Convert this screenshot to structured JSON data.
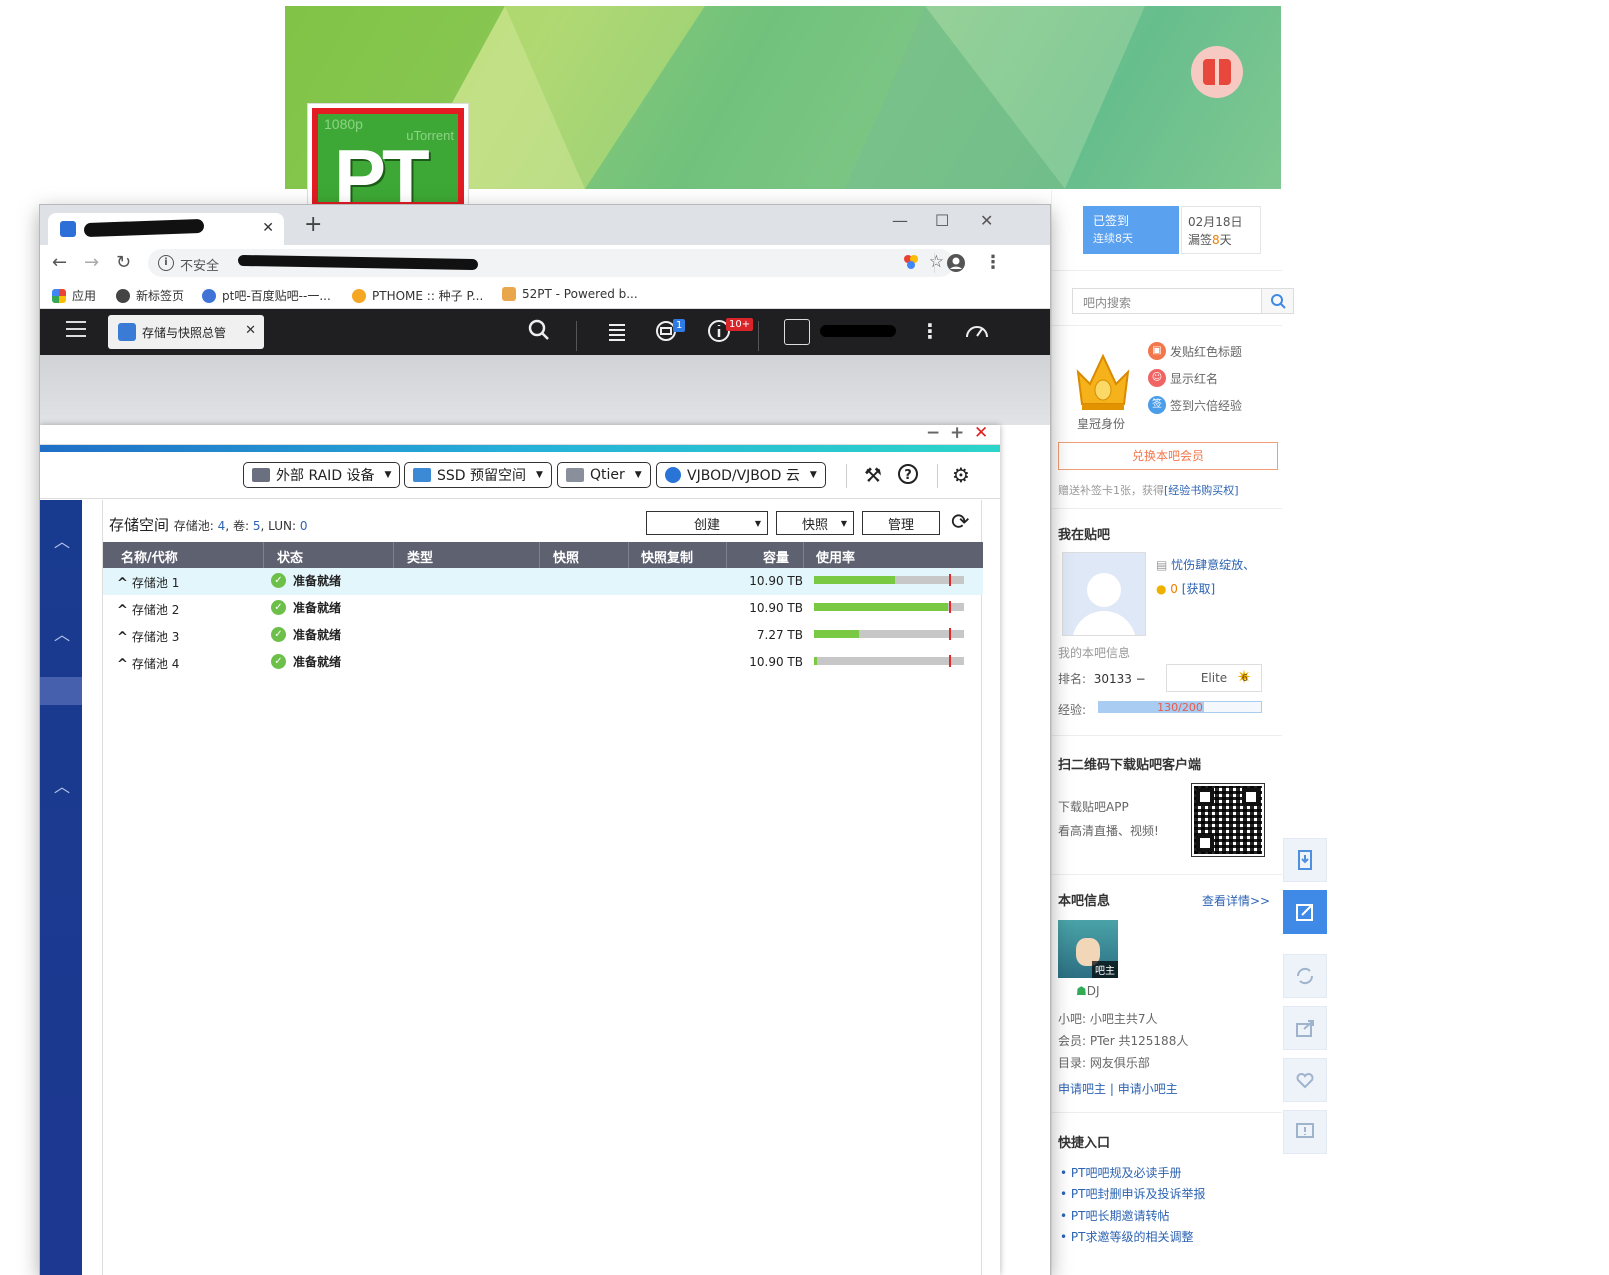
{
  "tieba": {
    "signin": {
      "status": "已签到",
      "streak": "连续8天"
    },
    "signdate": {
      "date": "02月18日",
      "missed_prefix": "漏签",
      "missed_num": "8",
      "missed_suffix": "天"
    },
    "search_placeholder": "吧内搜索",
    "crown_label": "皇冠身份",
    "perks": [
      "发贴红色标题",
      "显示红名",
      "签到六倍经验"
    ],
    "vip_button": "兑换本吧会员",
    "vip_note": "赠送补签卡1张，获得",
    "vip_note_link": "[经验书购买权]",
    "my_section_title": "我在贴吧",
    "my_name": "忧伤肆意绽放、",
    "my_coins": "0",
    "my_coins_link": "[获取]",
    "my_info_label": "我的本吧信息",
    "rank_label": "排名:",
    "rank_value": "30133 −",
    "level_name": "Elite",
    "level_num": "6",
    "exp_label": "经验:",
    "exp_text": "130/200",
    "exp_progress": 0.65,
    "qr_title": "扫二维码下载贴吧客户端",
    "qr_line1": "下载贴吧APP",
    "qr_line2": "看高清直播、视频!",
    "bar_info_title": "本吧信息",
    "bar_info_link": "查看详情>>",
    "bar_admin_tag": "吧主",
    "bar_admin_name": "DJ",
    "small_admins": "小吧: 小吧主共7人",
    "members": "会员: PTer 共125188人",
    "category": "目录: 网友俱乐部",
    "apply_admin": "申请吧主",
    "apply_small_admin": "申请小吧主",
    "quick_title": "快捷入口",
    "quick_links": [
      "PT吧吧规及必读手册",
      "PT吧封删申诉及投诉举报",
      "PT吧长期邀请转帖",
      "PT求邀等级的相关调整"
    ]
  },
  "browser": {
    "new_tab": "+",
    "not_secure": "不安全",
    "bookmarks": [
      "应用",
      "新标签页",
      "pt吧-百度贴吧--一...",
      "PTHOME :: 种子 P...",
      "52PT - Powered b..."
    ]
  },
  "qts": {
    "app_tab": "存储与快照总管",
    "badge_tasks": "1",
    "badge_notify": "10+"
  },
  "app": {
    "dropdowns": [
      "外部 RAID 设备",
      "SSD 预留空间",
      "Qtier",
      "VJBOD/VJBOD 云"
    ],
    "pane_title": "存储空间",
    "pool_label": "存储池:",
    "pool_count": "4",
    "vol_label": "卷:",
    "vol_count": "5",
    "lun_label": "LUN:",
    "lun_count": "0",
    "create_btn": "创建",
    "snapshot_btn": "快照",
    "manage_btn": "管理",
    "columns": [
      "名称/代称",
      "状态",
      "类型",
      "快照",
      "快照复制",
      "容量",
      "使用率"
    ],
    "rows": [
      {
        "name": "存储池 1",
        "status": "准备就绪",
        "capacity": "10.90 TB",
        "usage": 0.54
      },
      {
        "name": "存储池 2",
        "status": "准备就绪",
        "capacity": "10.90 TB",
        "usage": 0.89
      },
      {
        "name": "存储池 3",
        "status": "准备就绪",
        "capacity": "7.27 TB",
        "usage": 0.3
      },
      {
        "name": "存储池 4",
        "status": "准备就绪",
        "capacity": "10.90 TB",
        "usage": 0.02
      }
    ]
  },
  "colors": {
    "qts_dark": "#1f1f21",
    "nav_blue": "#1d3890",
    "usage_green": "#7ac943",
    "threshold_red": "#e22a2a",
    "tieba_blue": "#5aa1f0"
  }
}
